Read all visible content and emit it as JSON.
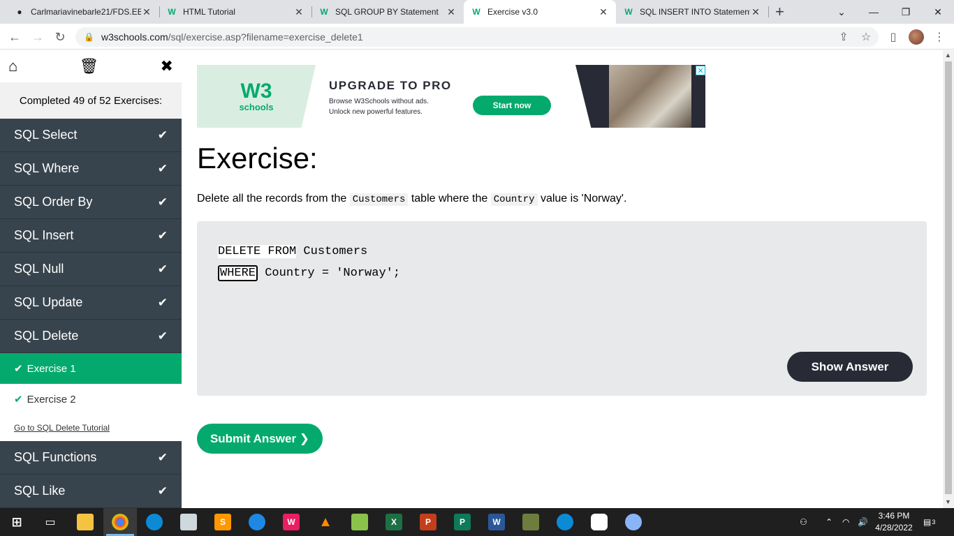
{
  "browser": {
    "tabs": [
      {
        "title": "Carlmariavinebarle21/FDS.EE",
        "favicon": "github-icon"
      },
      {
        "title": "HTML Tutorial",
        "favicon": "w3schools-icon"
      },
      {
        "title": "SQL GROUP BY Statement",
        "favicon": "w3schools-icon"
      },
      {
        "title": "Exercise v3.0",
        "favicon": "w3schools-icon",
        "active": true
      },
      {
        "title": "SQL INSERT INTO Statement",
        "favicon": "w3schools-icon"
      }
    ],
    "url_host": "w3schools.com",
    "url_path": "/sql/exercise.asp?filename=exercise_delete1"
  },
  "sidebar": {
    "progress_text": "Completed 49 of 52 Exercises:",
    "items_top": [
      {
        "label": "SQL Select",
        "done": true
      },
      {
        "label": "SQL Where",
        "done": true
      },
      {
        "label": "SQL Order By",
        "done": true
      },
      {
        "label": "SQL Insert",
        "done": true
      },
      {
        "label": "SQL Null",
        "done": true
      },
      {
        "label": "SQL Update",
        "done": true
      },
      {
        "label": "SQL Delete",
        "done": true
      }
    ],
    "sub_items": [
      {
        "label": "Exercise 1",
        "active": true
      },
      {
        "label": "Exercise 2",
        "active": false
      }
    ],
    "tutorial_link": "Go to SQL Delete Tutorial",
    "items_bottom": [
      {
        "label": "SQL Functions",
        "done": true
      },
      {
        "label": "SQL Like",
        "done": true
      }
    ]
  },
  "ad": {
    "logo_text": "W3",
    "logo_sub": "schools",
    "title": "UPGRADE TO PRO",
    "line1": "Browse W3Schools without ads.",
    "line2": "Unlock new powerful features.",
    "button": "Start now"
  },
  "exercise": {
    "heading": "Exercise:",
    "desc_part1": "Delete all the records from the ",
    "desc_code1": "Customers",
    "desc_part2": " table where the ",
    "desc_code2": "Country",
    "desc_part3": " value is 'Norway'.",
    "code_line1_kw": "DELETE FROM",
    "code_line1_rest": " Customers",
    "code_line2_input": "WHERE",
    "code_line2_rest": " Country = 'Norway';",
    "show_answer": "Show Answer",
    "submit": "Submit Answer ❯"
  },
  "taskbar": {
    "time": "3:46 PM",
    "date": "4/28/2022",
    "notifications": "3"
  },
  "colors": {
    "accent_green": "#04aa6d",
    "sidebar_dark": "#38444d",
    "button_dark": "#282a35"
  }
}
